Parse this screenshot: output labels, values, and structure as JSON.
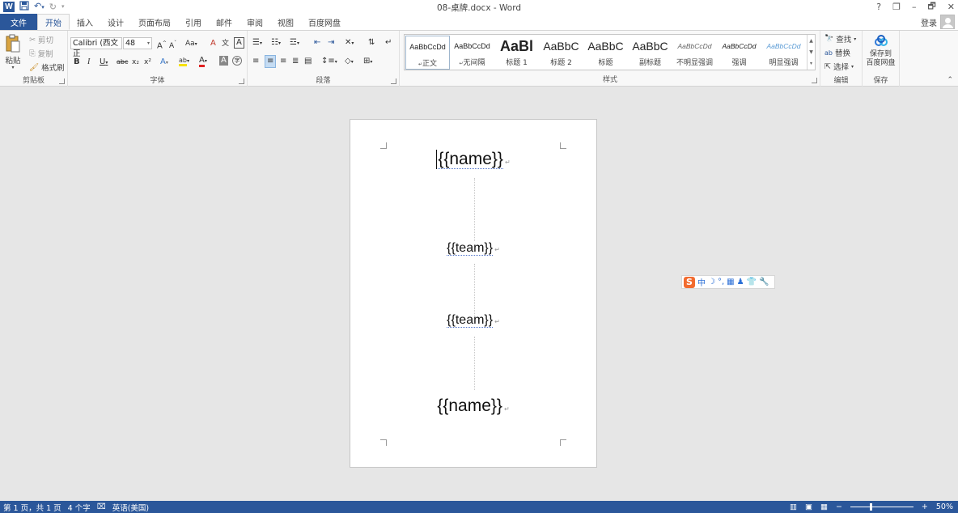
{
  "titlebar": {
    "title": "08-桌牌.docx - Word",
    "logo": "W",
    "qat": [
      "save-icon",
      "undo-icon",
      "redo-icon",
      "customize-icon"
    ],
    "controls": [
      "?",
      "❐",
      "–",
      "🗗",
      "✕"
    ]
  },
  "tabs": {
    "file": "文件",
    "items": [
      "开始",
      "插入",
      "设计",
      "页面布局",
      "引用",
      "邮件",
      "审阅",
      "视图",
      "百度网盘"
    ],
    "active": "开始",
    "login": "登录"
  },
  "ribbon": {
    "clipboard": {
      "label": "剪贴板",
      "paste": "粘贴",
      "cut": "剪切",
      "copy": "复制",
      "format_painter": "格式刷"
    },
    "font": {
      "label": "字体",
      "font_name": "Calibri (西文正",
      "font_size": "48",
      "bold": "B",
      "italic": "I",
      "underline": "U",
      "strike": "abc",
      "sub": "x₂",
      "sup": "x²",
      "grow": "A",
      "shrink": "A",
      "case": "Aa",
      "clear": "A",
      "phonetic": "文",
      "border": "A",
      "effect": "A",
      "highlight": "ab",
      "color": "A",
      "shade": "A",
      "enclose": "字"
    },
    "paragraph": {
      "label": "段落"
    },
    "styles": {
      "label": "样式",
      "items": [
        {
          "preview": "AaBbCcDd",
          "name": "正文"
        },
        {
          "preview": "AaBbCcDd",
          "name": "无间隔"
        },
        {
          "preview": "AaBl",
          "name": "标题 1"
        },
        {
          "preview": "AaBbC",
          "name": "标题 2"
        },
        {
          "preview": "AaBbC",
          "name": "标题"
        },
        {
          "preview": "AaBbC",
          "name": "副标题"
        },
        {
          "preview": "AaBbCcDd",
          "name": "不明显强调"
        },
        {
          "preview": "AaBbCcDd",
          "name": "强调"
        },
        {
          "preview": "AaBbCcDd",
          "name": "明显强调"
        }
      ]
    },
    "editing": {
      "label": "编辑",
      "find": "查找",
      "replace": "替换",
      "select": "选择"
    },
    "save": {
      "label": "保存",
      "button_line1": "保存到",
      "button_line2": "百度网盘"
    }
  },
  "document": {
    "placeholders": [
      "{{name}}",
      "{{team}}",
      "{{team}}",
      "{{name}}"
    ]
  },
  "ime": {
    "items": [
      "中",
      "☽",
      "°,",
      "▦",
      "♟",
      "👕",
      "🔧"
    ]
  },
  "statusbar": {
    "page": "第 1 页，共 1 页",
    "words": "4 个字",
    "language": "英语(美国)",
    "zoom": "50%"
  },
  "colors": {
    "accent": "#2b579a",
    "statusbar": "#2b579a"
  }
}
